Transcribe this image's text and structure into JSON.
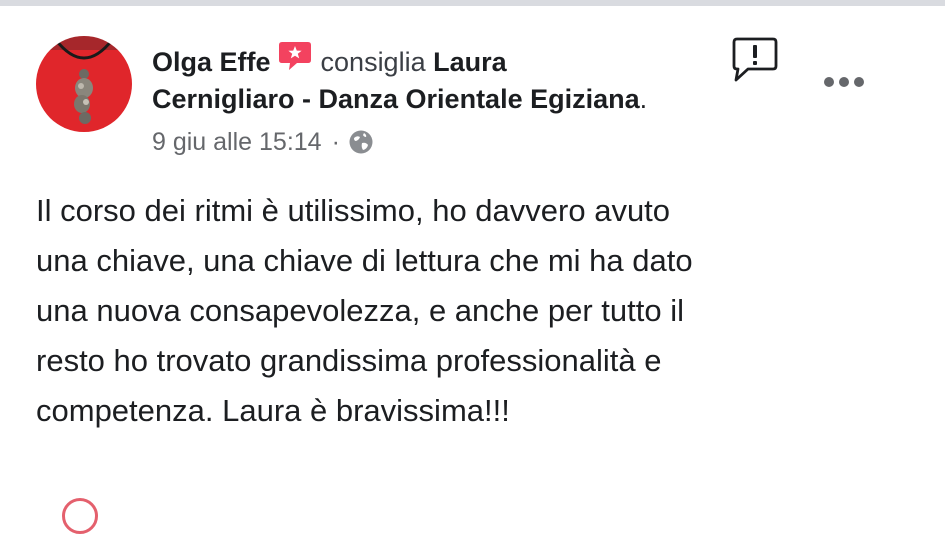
{
  "post": {
    "author_name": "Olga Effe",
    "verb": "consiglia",
    "page_name_line1": "Laura",
    "page_name_line2": "Cernigliaro - Danza Orientale Egiziana",
    "page_name_suffix": ".",
    "timestamp": "9 giu alle 15:14",
    "separator": "·",
    "body_lines": [
      "Il corso dei ritmi è utilissimo, ho davvero avuto",
      "una chiave, una chiave di lettura che mi ha dato",
      "una nuova consapevolezza, e anche per tutto il",
      "resto ho trovato grandissima professionalità e",
      "competenza. Laura è bravissima!!!"
    ]
  },
  "icons": {
    "recommend_badge": "recommend-badge-icon",
    "privacy": "globe-icon",
    "report": "report-icon",
    "more": "more-options-icon"
  },
  "colors": {
    "recommend_badge": "#f3425f",
    "avatar_background": "#e0262b",
    "text_primary": "#1c1e21",
    "text_secondary": "#65676b"
  }
}
